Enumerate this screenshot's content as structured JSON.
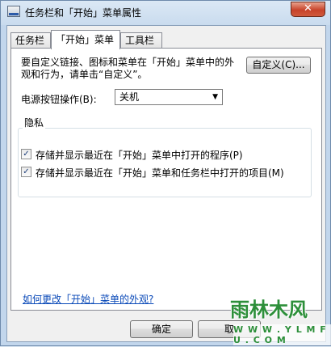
{
  "window": {
    "title": "任务栏和「开始」菜单属性",
    "close_glyph": "✕"
  },
  "tabs": [
    {
      "label": "任务栏",
      "active": false
    },
    {
      "label": "「开始」菜单",
      "active": true
    },
    {
      "label": "工具栏",
      "active": false
    }
  ],
  "start_menu": {
    "description": "要自定义链接、图标和菜单在「开始」菜单中的外观和行为，请单击“自定义”。",
    "customize_button": "自定义(C)...",
    "power_button_label": "电源按钮操作(B):",
    "power_button_value": "关机",
    "privacy_group_title": "隐私",
    "privacy_options": [
      {
        "label": "存储并显示最近在「开始」菜单中打开的程序(P)",
        "checked": true
      },
      {
        "label": "存储并显示最近在「开始」菜单和任务栏中打开的项目(M)",
        "checked": true
      }
    ],
    "help_link": "如何更改「开始」菜单的外观?"
  },
  "footer": {
    "ok_button": "确定",
    "cancel_button": "取"
  },
  "watermark": {
    "main": "雨林木风",
    "sub": "W W W . Y L M F U . C O M",
    "color": "#2d8f3a"
  }
}
